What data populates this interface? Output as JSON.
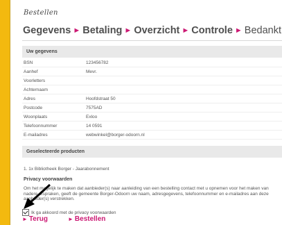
{
  "page": {
    "title": "Bestellen"
  },
  "steps": [
    "Gegevens",
    "Betaling",
    "Overzicht",
    "Controle",
    "Bedankt"
  ],
  "step_separator": "►",
  "personal": {
    "heading": "Uw gegevens",
    "fields": [
      {
        "label": "BSN",
        "value": "123456782"
      },
      {
        "label": "Aanhef",
        "value": "Mevr."
      },
      {
        "label": "Voorletters",
        "value": ""
      },
      {
        "label": "Achternaam",
        "value": ""
      },
      {
        "label": "Adres",
        "value": "Hoofdstraat 50"
      },
      {
        "label": "Postcode",
        "value": "7575AD"
      },
      {
        "label": "Woonplaats",
        "value": "Exloo"
      },
      {
        "label": "Telefoonnummer",
        "value": "14 0591"
      },
      {
        "label": "E-mailadres",
        "value": "webwinkel@borger-odoorn.nl"
      }
    ]
  },
  "products": {
    "heading": "Geselecteerde producten",
    "items": [
      "1. 1x Bibliotheek Borger - Jaarabonnement"
    ]
  },
  "privacy": {
    "heading": "Privacy voorwaarden",
    "text": "Om het mogelijk te maken dat aanbieder(s) naar aanleiding van een bestelling contact met u opnemen voor het maken van nadere afspraken, geeft de gemeente Borger-Odoorn uw naam, adresgegevens, telefoonnummer en e-mailadres aan deze aanbieder(s) verstrekken.",
    "agree_label": "Ik ga akkoord met de privacy voorwaarden",
    "agree_checked": true
  },
  "buttons": {
    "back": "Terug",
    "next": "Bestellen",
    "marker": "►"
  },
  "colors": {
    "accent": "#cc1a74",
    "background": "#f3b90f"
  },
  "icons": {
    "checkbox": "checkbox-checked-icon",
    "annotation": "pointer-arrow-icon"
  }
}
